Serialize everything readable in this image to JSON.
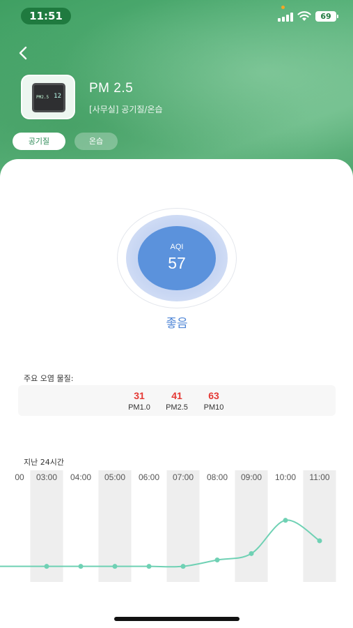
{
  "status_bar": {
    "time": "11:51",
    "battery": "69"
  },
  "header": {
    "back_icon": "chevron-left-icon",
    "device_title": "PM 2.5",
    "device_subtitle": "[사무실] 공기질/온습",
    "device_screen": {
      "label": "PM2.5",
      "value": "12"
    },
    "tabs": [
      {
        "label": "공기질",
        "active": true
      },
      {
        "label": "온습",
        "active": false
      }
    ],
    "background_color": "#4fa86d"
  },
  "aqi": {
    "label": "AQI",
    "value": "57",
    "status": "좋음",
    "color": "#5b92dc"
  },
  "pollutants": {
    "heading": "주요 오염 물질:",
    "items": [
      {
        "value": "31",
        "name": "PM1.0"
      },
      {
        "value": "41",
        "name": "PM2.5"
      },
      {
        "value": "63",
        "name": "PM10"
      }
    ],
    "value_color": "#e53935"
  },
  "chart_section": {
    "heading": "지난 24시간"
  },
  "chart_data": {
    "type": "line",
    "x_leading_partial_label": "00",
    "categories": [
      "03:00",
      "04:00",
      "05:00",
      "06:00",
      "07:00",
      "08:00",
      "09:00",
      "10:00",
      "11:00"
    ],
    "series": [
      {
        "values": [
          10,
          10,
          10,
          10,
          10,
          15,
          20,
          46,
          30
        ]
      }
    ],
    "ylim": [
      0,
      60
    ],
    "line_color": "#6fd1b4",
    "band_color": "#eeeeee",
    "grid": false
  }
}
